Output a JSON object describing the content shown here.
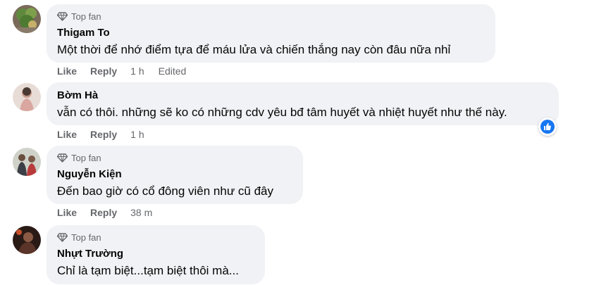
{
  "comments": [
    {
      "badge": "Top fan",
      "author": "Thigam To",
      "text": "Một thời để nhớ điểm tựa để máu lửa và chiến thắng nay còn đâu nữa nhỉ",
      "like": "Like",
      "reply": "Reply",
      "time": "1 h",
      "edited": "Edited"
    },
    {
      "author": "Bờm Hà",
      "text": "vẫn có thôi. những sẽ ko có những cdv yêu bđ tâm huyết và nhiệt huyết như thế này.",
      "like": "Like",
      "reply": "Reply",
      "time": "1 h",
      "reaction_icon": "like-reaction-icon"
    },
    {
      "badge": "Top fan",
      "author": "Nguyễn Kiện",
      "text": "Đến bao giờ có cổ đông viên như cũ đây",
      "like": "Like",
      "reply": "Reply",
      "time": "38 m"
    },
    {
      "badge": "Top fan",
      "author": "Nhựt Trường",
      "text": "Chỉ là tạm biệt...tạm biệt thôi mà..."
    }
  ],
  "colors": {
    "bubble": "#f0f2f5",
    "meta_text": "#65676b",
    "body_text": "#050505",
    "like_blue": "#1877f2"
  },
  "icons": {
    "top_fan": "diamond-icon",
    "reaction": "thumbs-up-icon"
  }
}
